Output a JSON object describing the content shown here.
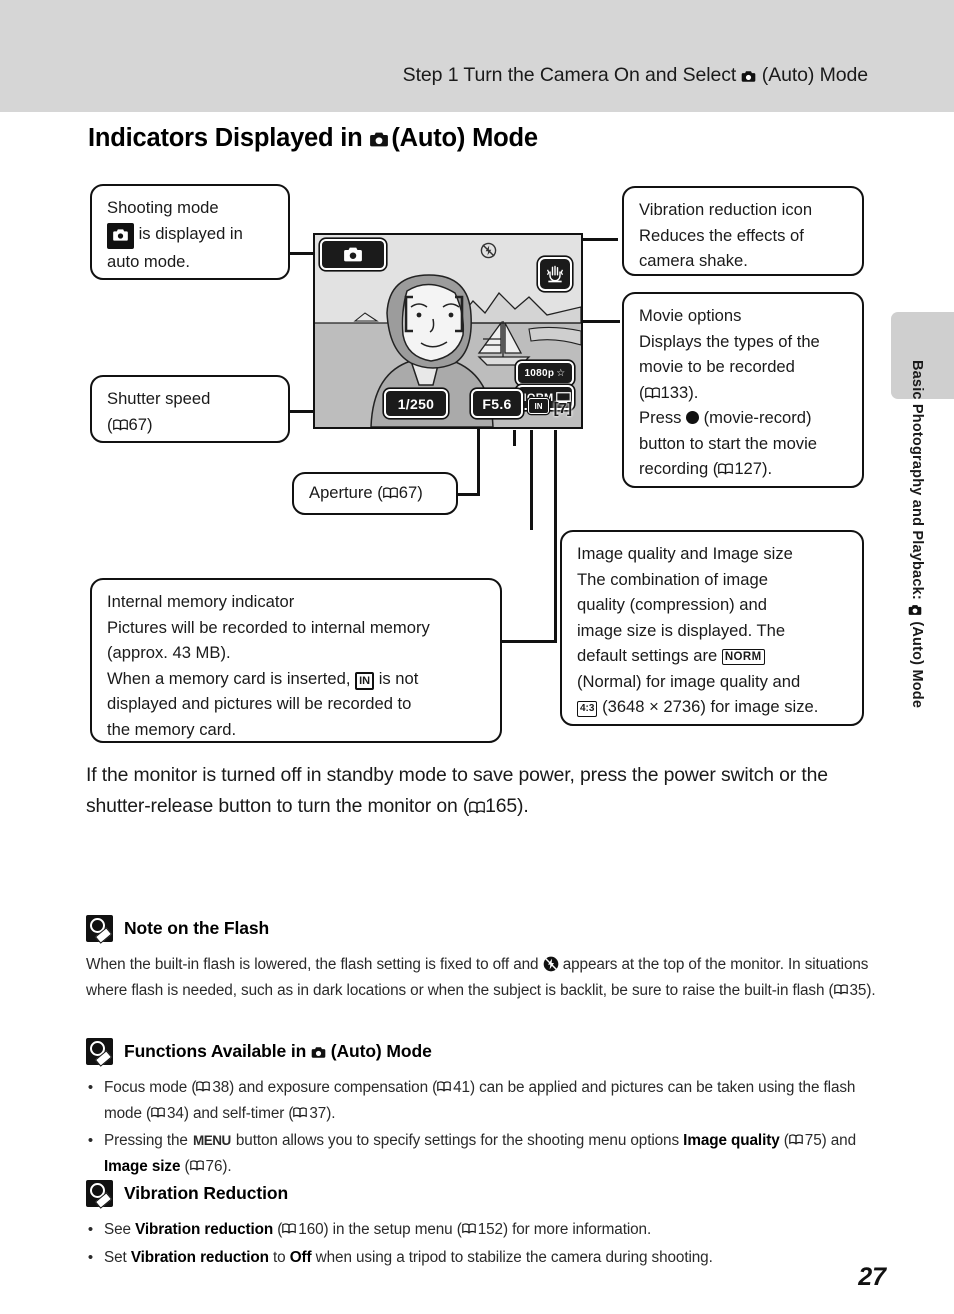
{
  "header": {
    "running_title": "Step 1 Turn the Camera On and Select ",
    "running_title_tail": " (Auto) Mode",
    "camera_icon": "camera-auto-icon"
  },
  "side_tab": {
    "label_head": "Basic Photography and Playback: ",
    "label_tail": " (Auto) Mode"
  },
  "page": {
    "heading_head": "Indicators Displayed in ",
    "heading_tail": " (Auto) Mode",
    "number": "27"
  },
  "callouts": {
    "shooting_mode": {
      "line1": "Shooting mode",
      "line2_tail": " is displayed in",
      "line3": "auto mode.",
      "icon": "camera-auto-icon"
    },
    "shutter_speed": {
      "line1": "Shutter speed",
      "ref": "67"
    },
    "aperture": {
      "label": "Aperture (",
      "ref": "67",
      "tail": ")"
    },
    "internal_memory": {
      "line1": "Internal memory indicator",
      "line2": "Pictures will be recorded to internal memory",
      "line3": "(approx. 43 MB).",
      "line4_pre": "When a memory card is inserted, ",
      "line4_icon": "IN",
      "line4_post": " is not",
      "line5": "displayed and pictures will be recorded to",
      "line6": "the memory card."
    },
    "vibration_reduction": {
      "line1": "Vibration reduction icon",
      "line2": "Reduces the effects of",
      "line3": "camera shake."
    },
    "movie_options": {
      "line1": "Movie options",
      "line2": "Displays the types of the",
      "line3": "movie to be recorded",
      "line4_ref": "133",
      "line5_pre": "Press ",
      "line5_post": " (movie-record)",
      "line6": "button to start the movie",
      "line7_pre": "recording (",
      "line7_ref": "127",
      "line7_post": ")."
    },
    "image_quality_size": {
      "line1": "Image quality and Image size",
      "line2": "The combination of image",
      "line3": "quality (compression) and",
      "line4": "image size is displayed. The",
      "line5_pre": "default settings are ",
      "line5_icon": "NORM",
      "line6": "(Normal) for image quality and",
      "line7_icon": "4:3",
      "line7_post": " (3648 × 2736) for image size."
    }
  },
  "lcd": {
    "mode_icon": "camera-auto-icon",
    "vr_icon": "vibration-reduction-icon",
    "flash_off_icon": "flash-off-icon",
    "movie_option": "1080p",
    "image_quality": "NORM",
    "image_size_icon": "image-size-icon",
    "shutter_speed": "1/250",
    "aperture": "F5.6",
    "internal_memory": "IN",
    "frames_remaining": "7"
  },
  "body_paragraph": {
    "pre": "If the monitor is turned off in standby mode to save power, press the power switch or the shutter-release button to turn the monitor on (",
    "ref": "165",
    "post": ")."
  },
  "notes": [
    {
      "id": "note-on-the-flash",
      "title": "Note on the Flash",
      "icon": "pencil-note-icon",
      "paragraph_pre": "When the built-in flash is lowered, the flash setting is fixed to off and ",
      "paragraph_mid": " appears at the top of the monitor. In situations where flash is needed, such as in dark locations or when the subject is backlit, be sure to raise the built-in flash (",
      "paragraph_ref": "35",
      "paragraph_post": ")."
    }
  ],
  "functions_section": {
    "title_head": "Functions Available in ",
    "title_tail": " (Auto) Mode",
    "icon": "pencil-note-icon",
    "bullets": [
      {
        "parts": [
          {
            "t": "Focus mode (",
            "b": false
          },
          {
            "t": "38",
            "b": false,
            "book": true
          },
          {
            "t": ") and exposure compensation (",
            "b": false
          },
          {
            "t": "41",
            "b": false,
            "book": true
          },
          {
            "t": ") can be applied and pictures can be taken using the flash mode (",
            "b": false
          },
          {
            "t": "34",
            "b": false,
            "book": true
          },
          {
            "t": ") and self-timer (",
            "b": false
          },
          {
            "t": "37",
            "b": false,
            "book": true
          },
          {
            "t": ").",
            "b": false
          }
        ]
      },
      {
        "parts": [
          {
            "t": "Pressing the ",
            "b": false
          },
          {
            "t": "MENU",
            "b": false,
            "menu": true
          },
          {
            "t": " button allows you to specify settings for the shooting menu options ",
            "b": false
          },
          {
            "t": "Image quality",
            "b": true
          },
          {
            "t": " (",
            "b": false
          },
          {
            "t": "75",
            "b": false,
            "book": true
          },
          {
            "t": ") and ",
            "b": false
          },
          {
            "t": "Image size",
            "b": true
          },
          {
            "t": " (",
            "b": false
          },
          {
            "t": "76",
            "b": false,
            "book": true
          },
          {
            "t": ").",
            "b": false
          }
        ]
      }
    ]
  },
  "vibration_section": {
    "title": "Vibration Reduction",
    "icon": "pencil-note-icon",
    "bullets": [
      {
        "parts": [
          {
            "t": "See ",
            "b": false
          },
          {
            "t": "Vibration reduction",
            "b": true
          },
          {
            "t": " (",
            "b": false
          },
          {
            "t": "160",
            "b": false,
            "book": true
          },
          {
            "t": ") in the setup menu (",
            "b": false
          },
          {
            "t": "152",
            "b": false,
            "book": true
          },
          {
            "t": ") for more information.",
            "b": false
          }
        ]
      },
      {
        "parts": [
          {
            "t": "Set ",
            "b": false
          },
          {
            "t": "Vibration reduction",
            "b": true
          },
          {
            "t": " to ",
            "b": false
          },
          {
            "t": "Off",
            "b": true
          },
          {
            "t": " when using a tripod to stabilize the camera during shooting.",
            "b": false
          }
        ]
      }
    ]
  },
  "colors": {
    "header_gray": "#d6d6d6",
    "tab_gray": "#cfcfcf",
    "ink": "#1a1a1a",
    "lcd_sky": "#e2e2e2",
    "lcd_sea": "#bdbdbd"
  }
}
